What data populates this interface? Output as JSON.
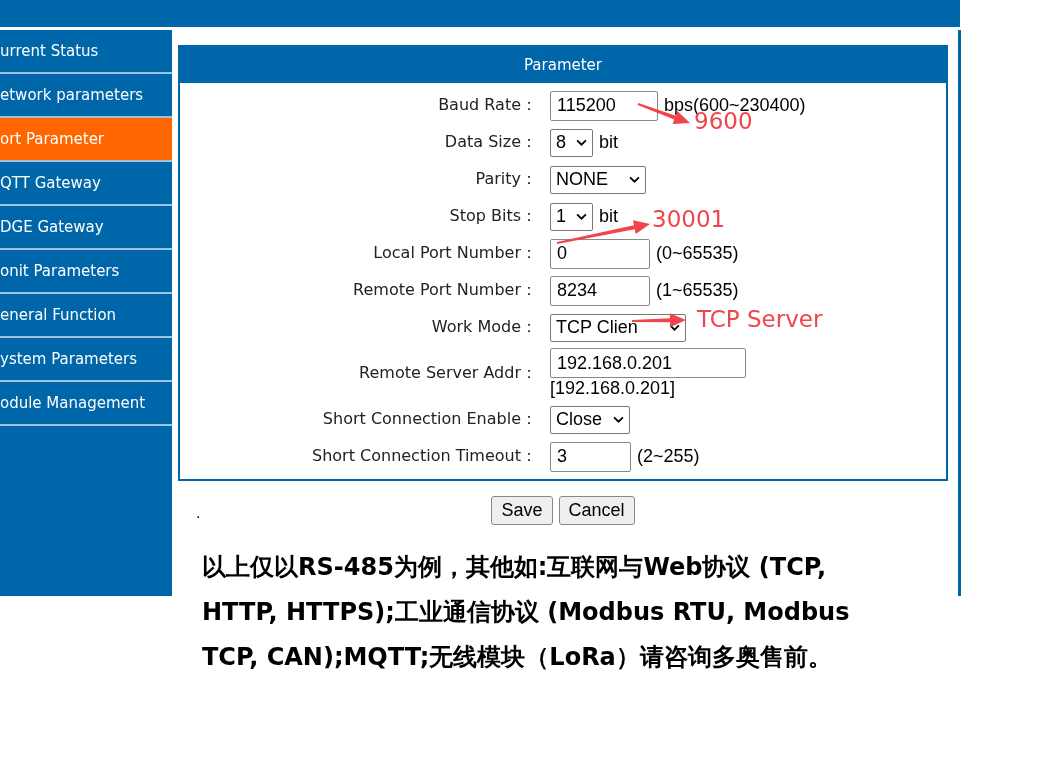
{
  "sidebar": {
    "items": [
      {
        "label": "urrent Status",
        "selected": false
      },
      {
        "label": "etwork parameters",
        "selected": false
      },
      {
        "label": "ort Parameter",
        "selected": true
      },
      {
        "label": "QTT Gateway",
        "selected": false
      },
      {
        "label": "DGE Gateway",
        "selected": false
      },
      {
        "label": "onit Parameters",
        "selected": false
      },
      {
        "label": "eneral Function",
        "selected": false
      },
      {
        "label": "ystem Parameters",
        "selected": false
      },
      {
        "label": "odule Management",
        "selected": false
      }
    ]
  },
  "panel": {
    "title": "Parameter",
    "fields": [
      {
        "label": "Baud Rate：",
        "kind": "input",
        "value": "115200",
        "hint": "bps(600~230400)"
      },
      {
        "label": "Data Size：",
        "kind": "select",
        "value": "8",
        "hint": "bit"
      },
      {
        "label": "Parity：",
        "kind": "select",
        "value": "NONE"
      },
      {
        "label": "Stop Bits：",
        "kind": "select",
        "value": "1",
        "hint": "bit"
      },
      {
        "label": "Local Port Number：",
        "kind": "input",
        "value": "0",
        "hint": "(0~65535)"
      },
      {
        "label": "Remote Port Number：",
        "kind": "input",
        "value": "8234",
        "hint": "(1~65535)"
      },
      {
        "label": "Work Mode：",
        "kind": "select",
        "value": "TCP Clien"
      },
      {
        "label": "Remote Server Addr：",
        "kind": "address",
        "value": "192.168.0.201",
        "hint": "[192.168.0.201]"
      },
      {
        "label": "Short Connection Enable：",
        "kind": "select",
        "value": "Close"
      },
      {
        "label": "Short Connection Timeout：",
        "kind": "input",
        "value": "3",
        "hint": "(2~255)"
      }
    ]
  },
  "buttons": [
    "Save",
    "Cancel"
  ],
  "annotations": [
    {
      "text": "9600"
    },
    {
      "text": "30001"
    },
    {
      "text": "TCP Server"
    }
  ],
  "note_mark": ".",
  "note": "以上仅以RS-485为例，其他如:互联网与Web协议 (TCP, HTTP, HTTPS);工业通信协议 (Modbus RTU, Modbus TCP, CAN);MQTT;无线模块（LoRa）请咨询多奥售前。"
}
